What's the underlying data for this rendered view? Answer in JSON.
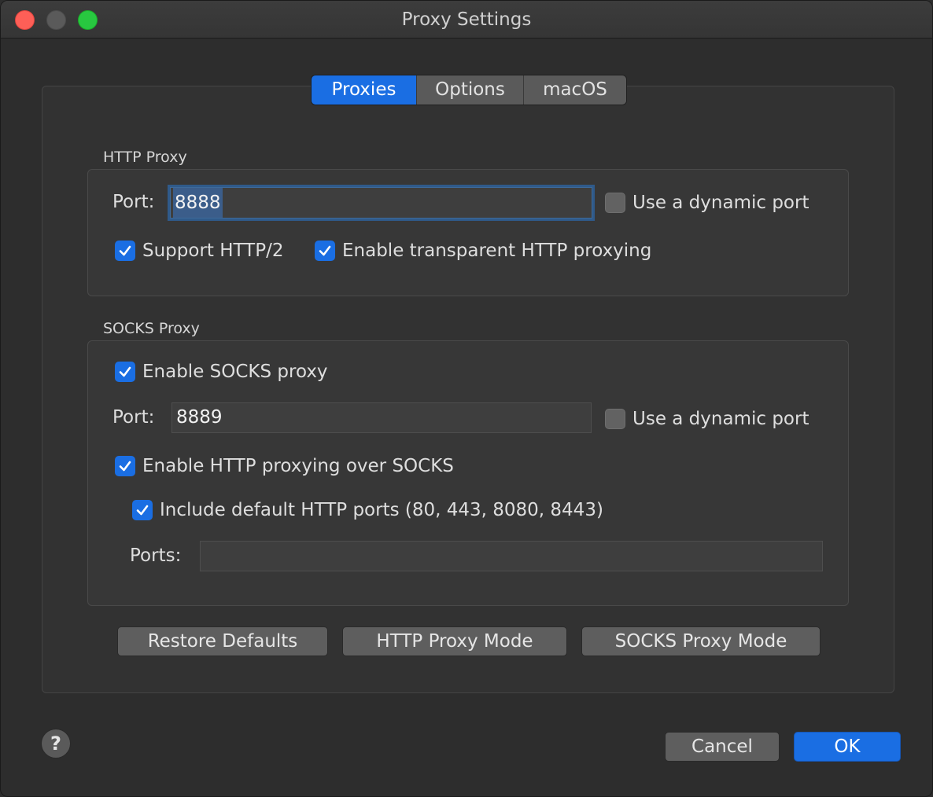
{
  "window": {
    "title": "Proxy Settings"
  },
  "tabs": [
    {
      "label": "Proxies",
      "active": true
    },
    {
      "label": "Options",
      "active": false
    },
    {
      "label": "macOS",
      "active": false
    }
  ],
  "http_proxy": {
    "group_label": "HTTP Proxy",
    "port_label": "Port:",
    "port_value": "8888",
    "dynamic_port_label": "Use a dynamic port",
    "dynamic_port_checked": false,
    "support_http2_label": "Support HTTP/2",
    "support_http2_checked": true,
    "transparent_label": "Enable transparent HTTP proxying",
    "transparent_checked": true
  },
  "socks_proxy": {
    "group_label": "SOCKS Proxy",
    "enable_label": "Enable SOCKS proxy",
    "enable_checked": true,
    "port_label": "Port:",
    "port_value": "8889",
    "dynamic_port_label": "Use a dynamic port",
    "dynamic_port_checked": false,
    "http_over_socks_label": "Enable HTTP proxying over SOCKS",
    "http_over_socks_checked": true,
    "default_ports_label": "Include default HTTP ports (80, 443, 8080, 8443)",
    "default_ports_checked": true,
    "ports_label": "Ports:",
    "ports_value": ""
  },
  "buttons": {
    "restore_defaults": "Restore Defaults",
    "http_proxy_mode": "HTTP Proxy Mode",
    "socks_proxy_mode": "SOCKS Proxy Mode",
    "cancel": "Cancel",
    "ok": "OK",
    "help": "?"
  },
  "colors": {
    "accent": "#1a6ee3",
    "window_bg": "#2d2d2d",
    "close": "#fe5f57",
    "maximize": "#28c840"
  }
}
